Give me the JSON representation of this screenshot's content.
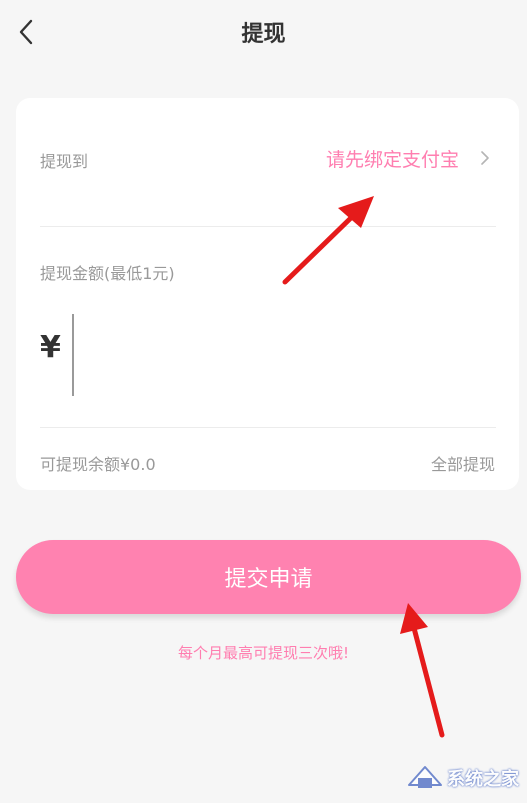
{
  "header": {
    "title": "提现"
  },
  "card": {
    "target_label": "提现到",
    "target_value": "请先绑定支付宝",
    "amount_label": "提现金额(最低1元)",
    "currency_symbol": "¥",
    "amount_value": "",
    "balance_text": "可提现余额¥0.0",
    "withdraw_all_label": "全部提现"
  },
  "submit_label": "提交申请",
  "note": "每个月最高可提现三次哦!",
  "watermark": {
    "text": "系统之家"
  },
  "colors": {
    "accent_pink": "#ff82b0",
    "text_pink": "#ff7eb0",
    "annotation_red": "#e51b1b",
    "background": "#f6f6f6"
  },
  "icons": {
    "back": "chevron-left-icon",
    "row_arrow": "chevron-right-icon"
  }
}
